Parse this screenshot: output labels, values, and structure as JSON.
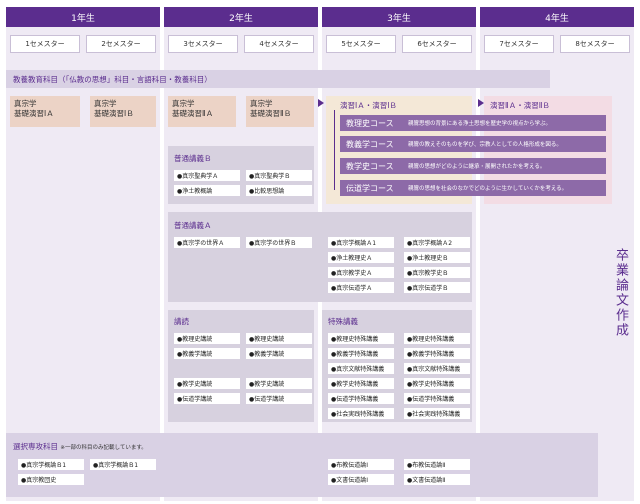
{
  "years": [
    "1年生",
    "2年生",
    "3年生",
    "4年生"
  ],
  "semesters": [
    "1セメスター",
    "2セメスター",
    "3セメスター",
    "4セメスター",
    "5セメスター",
    "6セメスター",
    "7セメスター",
    "8セメスター"
  ],
  "liberal": {
    "label": "教養教育科目（「仏教の思想」科目・言語科目・教養科目）"
  },
  "basic_seminars": [
    {
      "line1": "真宗学",
      "line2": "基礎演習ⅠＡ"
    },
    {
      "line1": "真宗学",
      "line2": "基礎演習ⅠＢ"
    },
    {
      "line1": "真宗学",
      "line2": "基礎演習ⅡＡ"
    },
    {
      "line1": "真宗学",
      "line2": "基礎演習ⅡＢ"
    }
  ],
  "seminar1": {
    "label": "演習ⅠＡ・演習ⅠＢ"
  },
  "seminar2": {
    "label": "演習ⅡＡ・演習ⅡＢ"
  },
  "courses": [
    {
      "name": "教理史コース",
      "desc": "親鸞思想の背景にある浄土思想を歴史学の視点から学ぶ。"
    },
    {
      "name": "教義学コース",
      "desc": "親鸞の教えそのものを学び、宗教人としての人格形成を図る。"
    },
    {
      "name": "教学史コース",
      "desc": "親鸞の思想がどのように継承・展開されたかを考える。"
    },
    {
      "name": "伝道学コース",
      "desc": "親鸞の思想を社会のなかでどのように生かしていくかを考える。"
    }
  ],
  "thesis": {
    "label": "卒業論文作成"
  },
  "general_b": {
    "title": "普通講義Ｂ",
    "items": [
      "●真宗聖典学Ａ",
      "●真宗聖典学Ｂ",
      "●浄土教概論",
      "●比較思想論"
    ]
  },
  "general_a": {
    "title": "普通講義Ａ",
    "year2": [
      "●真宗学の世界Ａ",
      "●真宗学の世界Ｂ"
    ],
    "year3": [
      "●真宗学概論Ａ1",
      "●真宗学概論Ａ2",
      "●浄土教理史Ａ",
      "●浄土教理史Ｂ",
      "●真宗教学史Ａ",
      "●真宗教学史Ｂ",
      "●真宗伝道学Ａ",
      "●真宗伝道学Ｂ"
    ]
  },
  "lectures": {
    "title": "講読",
    "items": [
      "●教理史講読",
      "●教理史講読",
      "●教義学講読",
      "●教義学講読",
      "●教学史講読",
      "●教学史講読",
      "●伝道学講読",
      "●伝道学講読"
    ]
  },
  "special": {
    "title": "特殊講義",
    "items": [
      "●教理史特殊講義",
      "●教理史特殊講義",
      "●教義学特殊講義",
      "●教義学特殊講義",
      "●真宗文献特殊講義",
      "●真宗文献特殊講義",
      "●教学史特殊講義",
      "●教学史特殊講義",
      "●伝道学特殊講義",
      "●伝道学特殊講義",
      "●社会実践特殊講義",
      "●社会実践特殊講義"
    ]
  },
  "elective": {
    "title": "選択専攻科目",
    "note": "※一部の科目のみ記載しています。",
    "year1": [
      "●真宗学概論Ｂ1",
      "●真宗学概論Ｂ1",
      "●真宗教団史"
    ],
    "year3": [
      "●布教伝道論Ⅰ",
      "●布教伝道論Ⅱ",
      "●文書伝道論Ⅰ",
      "●文書伝道論Ⅱ"
    ]
  },
  "colors": {
    "purple": "#5b2d8e",
    "course": "#8d6aa8",
    "pink": "#ecd3c6"
  }
}
